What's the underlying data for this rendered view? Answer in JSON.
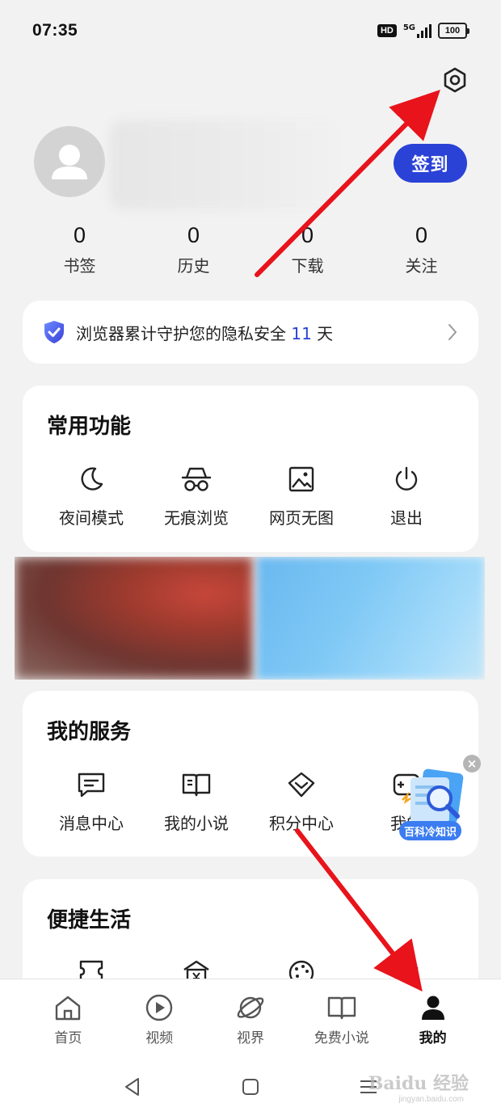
{
  "status_bar": {
    "time": "07:35",
    "hd_label": "HD",
    "network_label": "5G",
    "battery": "100"
  },
  "profile": {
    "checkin_label": "签到",
    "stats": [
      {
        "value": "0",
        "label": "书签"
      },
      {
        "value": "0",
        "label": "历史"
      },
      {
        "value": "0",
        "label": "下载"
      },
      {
        "value": "0",
        "label": "关注"
      }
    ]
  },
  "privacy": {
    "text_before": "浏览器累计守护您的隐私安全 ",
    "days": "11",
    "text_after": " 天"
  },
  "common_functions": {
    "title": "常用功能",
    "items": [
      {
        "label": "夜间模式",
        "icon": "moon-icon"
      },
      {
        "label": "无痕浏览",
        "icon": "incognito-icon"
      },
      {
        "label": "网页无图",
        "icon": "image-icon"
      },
      {
        "label": "退出",
        "icon": "power-icon"
      }
    ]
  },
  "my_services": {
    "title": "我的服务",
    "items": [
      {
        "label": "消息中心",
        "icon": "message-icon"
      },
      {
        "label": "我的小说",
        "icon": "book-icon"
      },
      {
        "label": "积分中心",
        "icon": "diamond-icon"
      },
      {
        "label": "我的",
        "icon": "game-icon"
      }
    ]
  },
  "float_widget": {
    "badge_label": "百科冷知识",
    "close_symbol": "×"
  },
  "convenient_life": {
    "title": "便捷生活"
  },
  "bottom_nav": [
    {
      "label": "首页",
      "icon": "home-icon",
      "active": false
    },
    {
      "label": "视频",
      "icon": "play-icon",
      "active": false
    },
    {
      "label": "视界",
      "icon": "planet-icon",
      "active": false
    },
    {
      "label": "免费小说",
      "icon": "book-open-icon",
      "active": false
    },
    {
      "label": "我的",
      "icon": "person-icon",
      "active": true
    }
  ],
  "watermark": {
    "brand": "Baidu 经验",
    "url": "jingyan.baidu.com"
  },
  "colors": {
    "accent": "#2a42d6",
    "annotation_arrow": "#e8131b",
    "background": "#f2f2f2"
  }
}
